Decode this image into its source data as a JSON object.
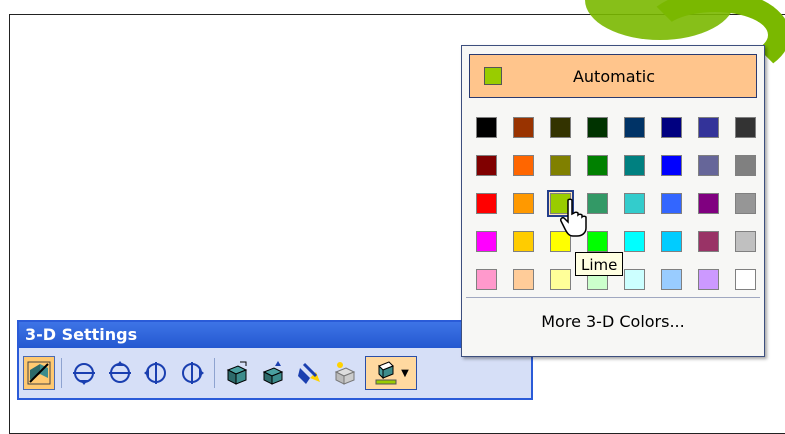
{
  "toolbar": {
    "title": "3-D Settings",
    "buttons": [
      {
        "name": "3d-on-off-icon"
      },
      {
        "name": "tilt-down-icon"
      },
      {
        "name": "tilt-up-icon"
      },
      {
        "name": "tilt-left-icon"
      },
      {
        "name": "tilt-right-icon"
      },
      {
        "name": "depth-icon"
      },
      {
        "name": "direction-icon"
      },
      {
        "name": "lighting-icon"
      },
      {
        "name": "surface-icon"
      },
      {
        "name": "3d-color-icon"
      }
    ]
  },
  "color_popup": {
    "automatic_label": "Automatic",
    "automatic_color": "#99cc00",
    "more_colors_label": "More 3-D Colors...",
    "tooltip": "Lime",
    "selected_color": "#99cc00",
    "colors": [
      "#000000",
      "#993300",
      "#333300",
      "#003300",
      "#003366",
      "#000080",
      "#333399",
      "#333333",
      "#800000",
      "#ff6600",
      "#808000",
      "#008000",
      "#008080",
      "#0000ff",
      "#666699",
      "#808080",
      "#ff0000",
      "#ff9900",
      "#99cc00",
      "#339966",
      "#33cccc",
      "#3366ff",
      "#800080",
      "#969696",
      "#ff00ff",
      "#ffcc00",
      "#ffff00",
      "#00ff00",
      "#00ffff",
      "#00ccff",
      "#993366",
      "#c0c0c0",
      "#ff99cc",
      "#ffcc99",
      "#ffff99",
      "#ccffcc",
      "#ccffff",
      "#99ccff",
      "#cc99ff",
      "#ffffff"
    ]
  },
  "colors": {
    "toolbar_title_bg": "#2a5bd8",
    "popup_bg": "#f7f7f5",
    "highlight": "#ffc58c"
  }
}
